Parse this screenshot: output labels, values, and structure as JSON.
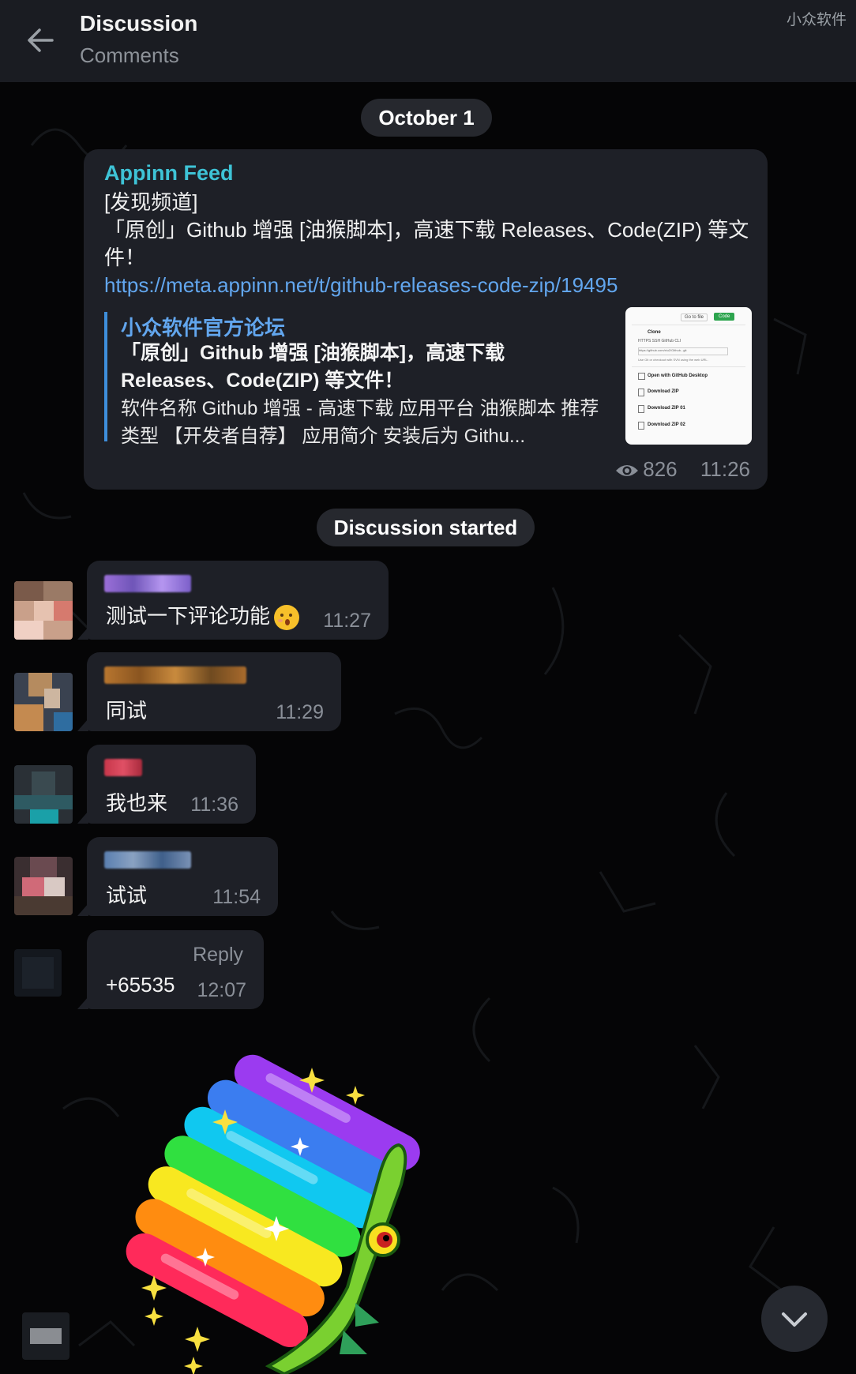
{
  "header": {
    "title": "Discussion",
    "subtitle": "Comments",
    "watermark": "小众软件"
  },
  "date_pill": "October 1",
  "channel_post": {
    "author": "Appinn Feed",
    "lines": [
      "[发现频道]",
      "「原创」Github 增强 [油猴脚本]，高速下载 Releases、Code(ZIP) 等文件！"
    ],
    "link": "https://meta.appinn.net/t/github-releases-code-zip/19495",
    "preview": {
      "site": "小众软件官方论坛",
      "title": "「原创」Github 增强 [油猴脚本]，高速下载 Releases、Code(ZIP) 等文件！",
      "description": "软件名称 Github 增强 - 高速下载   应用平台  油猴脚本   推荐类型 【开发者自荐】   应用简介 安装后为 Githu...",
      "thumb": {
        "goto_file": "Go to file",
        "code_button": "Code",
        "clone": "Clone",
        "tabs": "HTTPS   SSH   GitHub CLI",
        "url": "https://github.com/xiu2/Github...git",
        "hint": "Use Git or checkout with SVN using the web URL.",
        "items": [
          "Open with GitHub Desktop",
          "Download ZIP",
          "Download ZIP 01",
          "Download ZIP 02"
        ]
      }
    },
    "views": "826",
    "time": "11:26"
  },
  "discussion_pill": "Discussion started",
  "comments": [
    {
      "text": "测试一下评论功能",
      "time": "11:27",
      "name_color": "#9b6fd8"
    },
    {
      "text": "同试",
      "time": "11:29",
      "name_color": "#b8762f"
    },
    {
      "text": "我也来",
      "time": "11:36",
      "name_color": "#c7364a"
    },
    {
      "text": "试试",
      "time": "11:54",
      "name_color": "#5a7fb0"
    },
    {
      "text": "+65535",
      "time": "12:07",
      "reply_label": "Reply"
    }
  ],
  "icons": {
    "back": "arrow-left-icon",
    "views": "eye-icon",
    "scroll": "chevron-down-icon",
    "sticker": "rainbow-crocodile-sticker",
    "emoji": "kissing-face-icon"
  },
  "colors": {
    "accent": "#3ec3d6",
    "link": "#62a6ee",
    "bubble": "#1e2027",
    "header": "#1a1c22"
  }
}
